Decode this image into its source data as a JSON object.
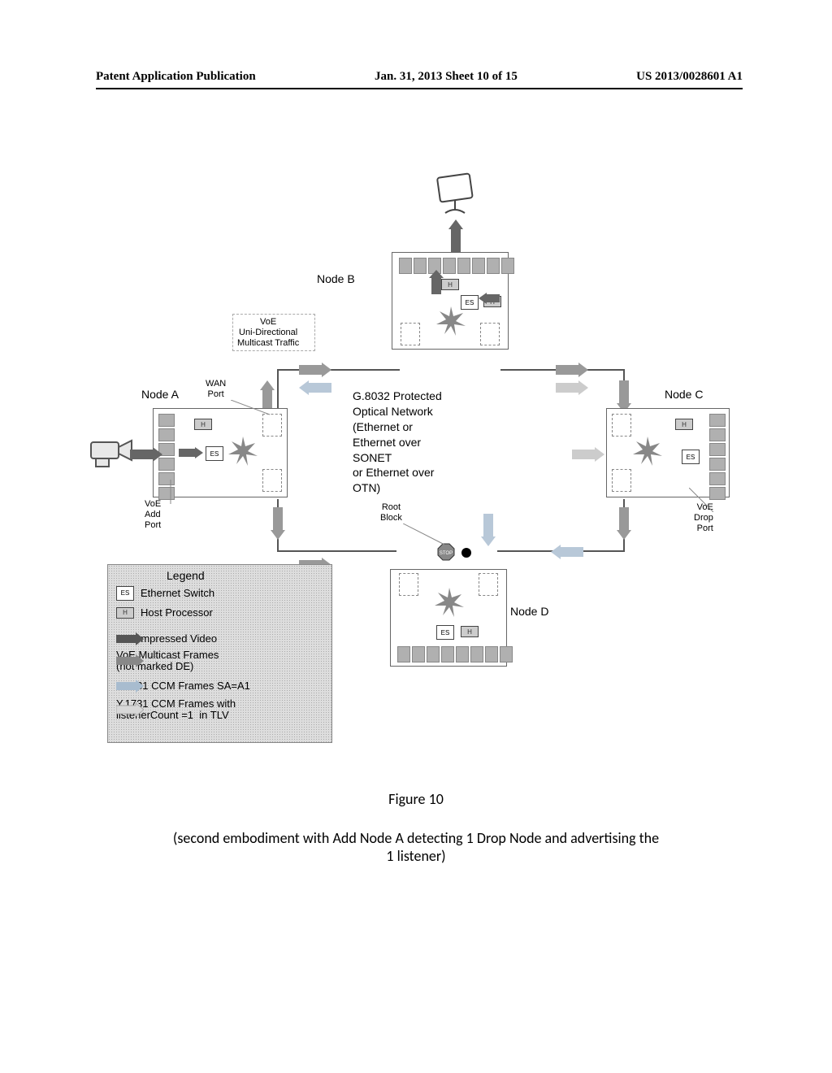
{
  "header": {
    "left": "Patent Application Publication",
    "center": "Jan. 31, 2013  Sheet 10 of 15",
    "right": "US 2013/0028601 A1"
  },
  "labels": {
    "node_a": "Node A",
    "node_b": "Node B",
    "node_c": "Node C",
    "node_d": "Node D",
    "voe_multicast": "VoE\nUni-Directional\nMulticast Traffic",
    "wan_port": "WAN\nPort",
    "voe_add_port": "VoE\nAdd\nPort",
    "voe_drop_port": "VoE\nDrop\nPort",
    "root_block": "Root\nBlock",
    "network": "G.8032 Protected\nOptical Network\n(Ethernet or\nEthernet over\nSONET\nor Ethernet over\nOTN)",
    "es": "ES",
    "hp": "H"
  },
  "legend": {
    "title": "Legend",
    "items": [
      {
        "kind": "chip-es",
        "text": "Ethernet Switch"
      },
      {
        "kind": "chip-hp",
        "text": "Host Processor"
      },
      {
        "kind": "arrow-dark",
        "text": "Uncompressed Video"
      },
      {
        "kind": "arrow-med",
        "text": "VoE Multicast Frames\n(not marked DE)"
      },
      {
        "kind": "arrow-blue",
        "text": "Y.1731 CCM Frames SA=A1"
      },
      {
        "kind": "arrow-light",
        "text": "Y.1731 CCM Frames with\nlistenerCount =1  in TLV"
      }
    ]
  },
  "caption": {
    "fig": "Figure 10",
    "desc": "(second embodiment with Add Node A detecting 1 Drop Node and advertising the\n1 listener)"
  }
}
